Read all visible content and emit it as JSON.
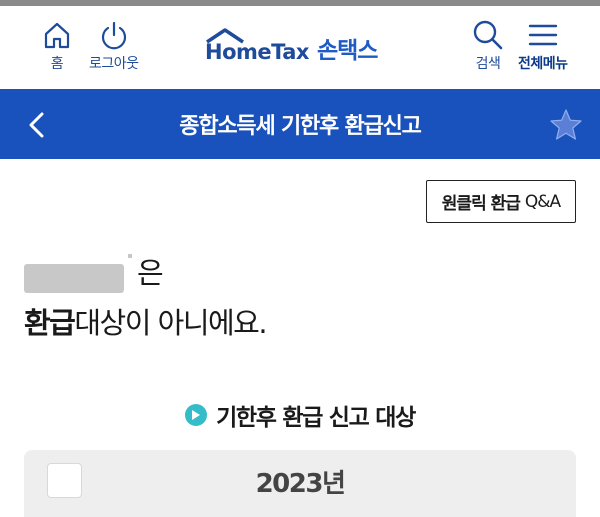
{
  "header": {
    "home_label": "홈",
    "logout_label": "로그아웃",
    "logo_en": "HomeTax",
    "logo_ko": "손택스",
    "search_label": "검색",
    "menu_label": "전체메뉴"
  },
  "titlebar": {
    "title": "종합소득세 기한후 환급신고"
  },
  "qa_button": {
    "bold": "원클릭 환급",
    "normal": "Q&A"
  },
  "message": {
    "line1_suffix": "은",
    "line2_strong": "환급",
    "line2_rest": "대상이 아니에요."
  },
  "section": {
    "title": "기한후 환급 신고 대상"
  },
  "year_card": {
    "year": "2023년"
  },
  "colors": {
    "brand_blue": "#1a52bd",
    "accent_teal": "#35bcc9"
  }
}
